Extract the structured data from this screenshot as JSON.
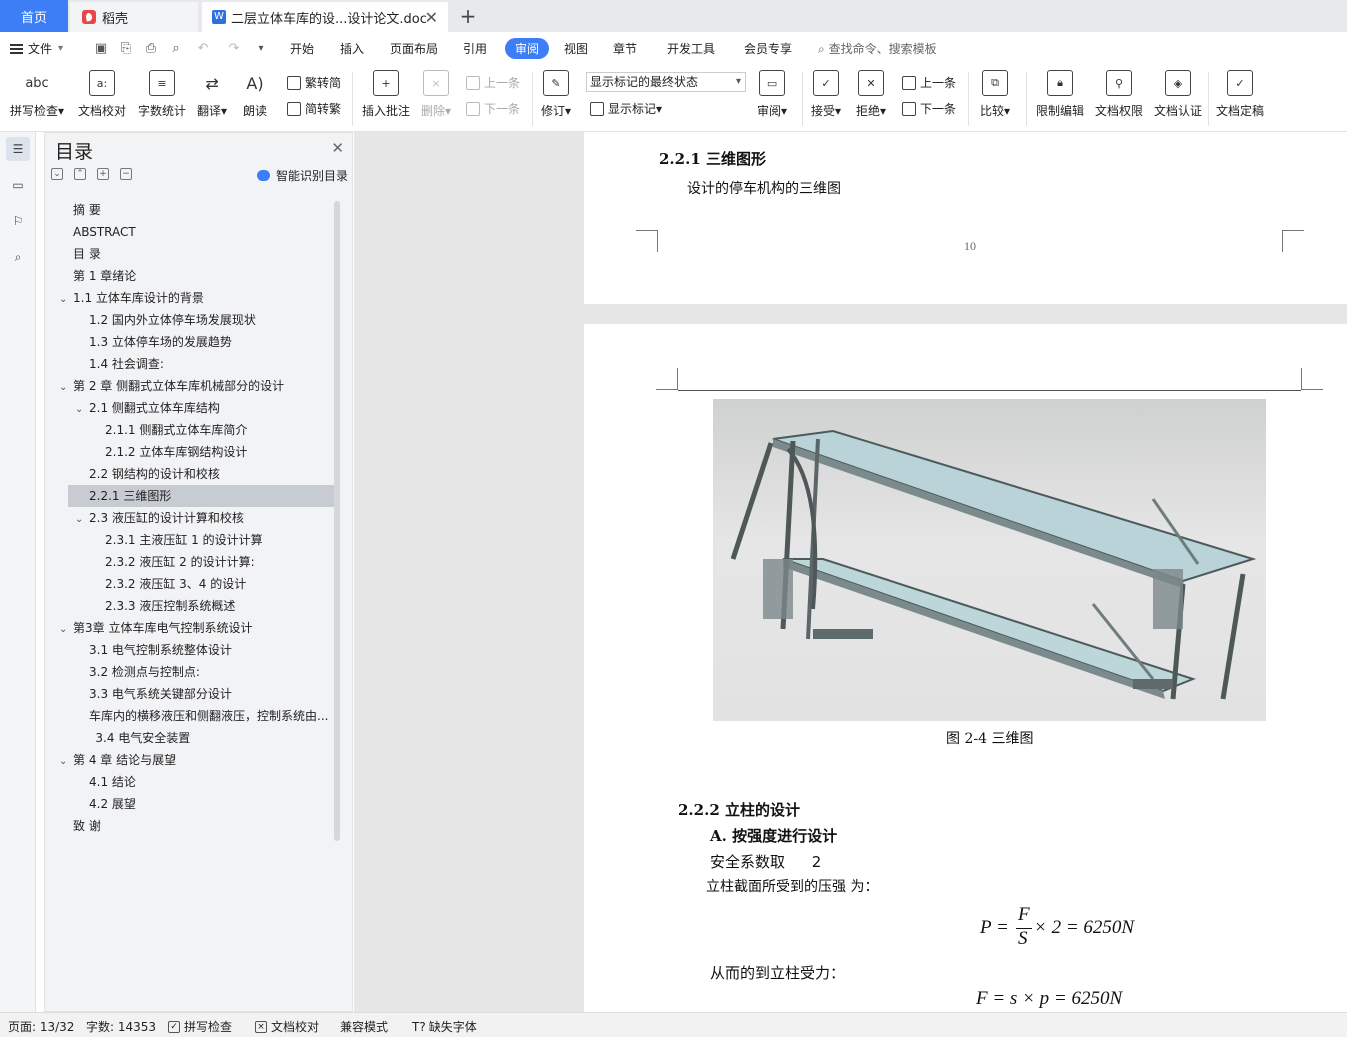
{
  "tabs": {
    "home": "首页",
    "daoke": "稻壳",
    "document": "二层立体车库的设...设计论文.doc",
    "new_tab": "+"
  },
  "menu": {
    "file": "文件",
    "items": [
      "开始",
      "插入",
      "页面布局",
      "引用",
      "审阅",
      "视图",
      "章节",
      "开发工具",
      "会员专享"
    ],
    "active": "审阅",
    "search": "查找命令、搜索模板"
  },
  "ribbon": {
    "spell_check": "拼写检查",
    "doc_proof": "文档校对",
    "word_count": "字数统计",
    "translate": "翻译",
    "read_aloud": "朗读",
    "trad_to_simp": "繁转简",
    "simp_to_trad": "简转繁",
    "insert_comment": "插入批注",
    "delete": "删除",
    "prev_comment": "上一条",
    "next_comment": "下一条",
    "track_changes": "修订",
    "markup_mode": "显示标记的最终状态",
    "show_markup": "显示标记",
    "review": "审阅",
    "accept": "接受",
    "reject": "拒绝",
    "prev_change": "上一条",
    "next_change": "下一条",
    "compare": "比较",
    "restrict_edit": "限制编辑",
    "doc_permission": "文档权限",
    "doc_cert": "文档认证",
    "doc_finalize": "文档定稿"
  },
  "toc": {
    "title": "目录",
    "smart": "智能识别目录",
    "items": [
      {
        "text": "摘  要",
        "level": 0,
        "chev": ""
      },
      {
        "text": "ABSTRACT",
        "level": 0,
        "chev": ""
      },
      {
        "text": "目  录",
        "level": 0,
        "chev": ""
      },
      {
        "text": "第 1 章绪论",
        "level": 0,
        "chev": ""
      },
      {
        "text": "1.1  立体车库设计的背景",
        "level": 0,
        "chev": "v"
      },
      {
        "text": "1.2  国内外立体停车场发展现状",
        "level": 1,
        "chev": ""
      },
      {
        "text": "1.3  立体停车场的发展趋势",
        "level": 1,
        "chev": ""
      },
      {
        "text": "1.4  社会调查:",
        "level": 1,
        "chev": ""
      },
      {
        "text": "第 2 章  侧翻式立体车库机械部分的设计",
        "level": 0,
        "chev": "v"
      },
      {
        "text": "2.1  侧翻式立体车库结构",
        "level": 1,
        "chev": "v"
      },
      {
        "text": "2.1.1  侧翻式立体车库简介",
        "level": 2,
        "chev": ""
      },
      {
        "text": "2.1.2    立体车库钢结构设计",
        "level": 2,
        "chev": ""
      },
      {
        "text": "2.2  钢结构的设计和校核",
        "level": 1,
        "chev": ""
      },
      {
        "text": "2.2.1  三维图形",
        "level": 1,
        "chev": "",
        "selected": true
      },
      {
        "text": "2.3  液压缸的设计计算和校核",
        "level": 1,
        "chev": "v"
      },
      {
        "text": "2.3.1 主液压缸 1 的设计计算",
        "level": 2,
        "chev": ""
      },
      {
        "text": "2.3.2 液压缸 2 的设计计算:",
        "level": 2,
        "chev": ""
      },
      {
        "text": "2.3.2  液压缸 3、4 的设计",
        "level": 2,
        "chev": ""
      },
      {
        "text": "2.3.3  液压控制系统概述",
        "level": 2,
        "chev": ""
      },
      {
        "text": "第3章  立体车库电气控制系统设计",
        "level": 0,
        "chev": "v"
      },
      {
        "text": "3.1  电气控制系统整体设计",
        "level": 1,
        "chev": ""
      },
      {
        "text": "3.2  检测点与控制点:",
        "level": 1,
        "chev": ""
      },
      {
        "text": "3.3  电气系统关键部分设计",
        "level": 1,
        "chev": ""
      },
      {
        "text": "车库内的横移液压和侧翻液压，控制系统由...",
        "level": 1,
        "chev": ""
      },
      {
        "text": "3.4  电气安全装置",
        "level": 1.4,
        "chev": ""
      },
      {
        "text": "第 4 章  结论与展望",
        "level": 0,
        "chev": "v"
      },
      {
        "text": "4.1    结论",
        "level": 1,
        "chev": ""
      },
      {
        "text": "4.2    展望",
        "level": 1,
        "chev": ""
      },
      {
        "text": "致  谢",
        "level": 0,
        "chev": ""
      }
    ]
  },
  "doc": {
    "page1_heading": "2.2.1  三维图形",
    "page1_text": "设计的停车机构的三维图",
    "page_number": "10",
    "figure_caption": "图 2-4  三维图",
    "heading_222": "2.2.2  立柱的设计",
    "sub_a": "A.    按强度进行设计",
    "safety_factor_label": "安全系数取",
    "safety_factor_value": "2",
    "pressure_text": "立柱截面所受到的压强  为：",
    "force_text": "从而的到立柱受力：",
    "formula1_lhs": "P =",
    "formula1_num": "F",
    "formula1_den": "S",
    "formula1_rhs": "× 2 = 6250N",
    "formula2": "F = s × p = 6250N"
  },
  "status": {
    "page": "页面: 13/32",
    "words": "字数: 14353",
    "spell": "拼写检查",
    "proof": "文档校对",
    "compat": "兼容模式",
    "missing_font": "缺失字体"
  }
}
